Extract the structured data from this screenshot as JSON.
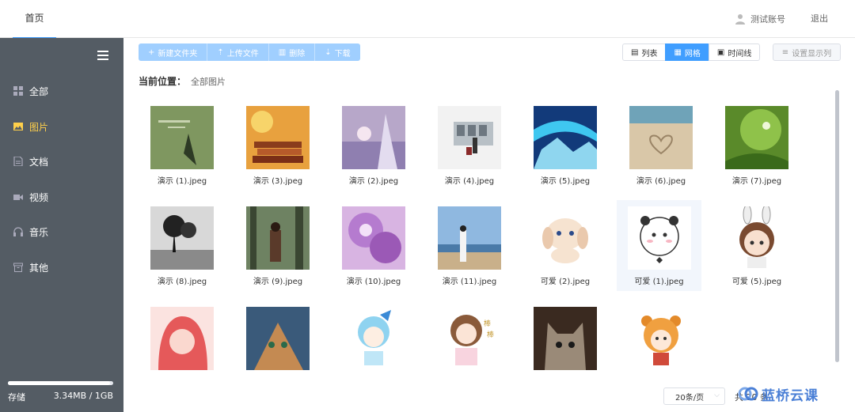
{
  "header": {
    "tab": "首页",
    "user": "测试账号",
    "logout": "退出"
  },
  "sidebar": {
    "items": [
      {
        "label": "全部",
        "icon": "grid-icon"
      },
      {
        "label": "图片",
        "icon": "image-icon",
        "active": true
      },
      {
        "label": "文档",
        "icon": "document-icon"
      },
      {
        "label": "视频",
        "icon": "video-icon"
      },
      {
        "label": "音乐",
        "icon": "headphones-icon"
      },
      {
        "label": "其他",
        "icon": "box-icon"
      }
    ],
    "storage_label": "存储",
    "storage_value": "3.34MB / 1GB",
    "storage_used_fraction": 0.97
  },
  "toolbar": {
    "new_folder": "新建文件夹",
    "upload": "上传文件",
    "delete": "删除",
    "download": "下载",
    "view_list": "列表",
    "view_grid": "网格",
    "view_timeline": "时间线",
    "columns": "设置显示列"
  },
  "breadcrumb": {
    "label": "当前位置：",
    "path": "全部图片"
  },
  "files": [
    {
      "name": "演示 (1).jpeg"
    },
    {
      "name": "演示 (3).jpeg"
    },
    {
      "name": "演示 (2).jpeg"
    },
    {
      "name": "演示 (4).jpeg"
    },
    {
      "name": "演示 (5).jpeg"
    },
    {
      "name": "演示 (6).jpeg"
    },
    {
      "name": "演示 (7).jpeg"
    },
    {
      "name": "演示 (8).jpeg"
    },
    {
      "name": "演示 (9).jpeg"
    },
    {
      "name": "演示 (10).jpeg"
    },
    {
      "name": "演示 (11).jpeg"
    },
    {
      "name": "可爱 (2).jpeg"
    },
    {
      "name": "可爱 (1).jpeg"
    },
    {
      "name": "可爱 (5).jpeg"
    }
  ],
  "pagination": {
    "page_size": "20条/页",
    "total": "共 20 条"
  },
  "watermark": {
    "text": "蓝桥云课"
  },
  "colors": {
    "accent": "#409eff",
    "sidebar": "#545c64",
    "active_nav": "#ffd04b",
    "toolbar_disabled": "#a0cfff"
  }
}
